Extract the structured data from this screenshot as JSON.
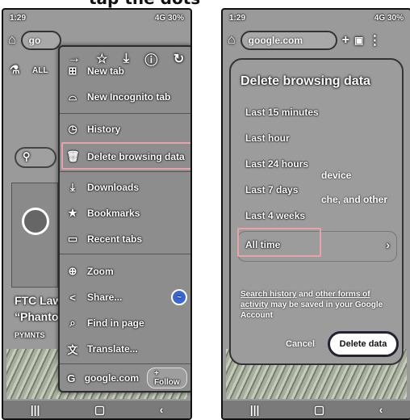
{
  "caption": "tap the dots",
  "left": {
    "status": {
      "time": "1:29",
      "indicators": "4G 30%"
    },
    "omnibox_text": "go",
    "menu": {
      "top_icons": [
        "forward-icon",
        "star-icon",
        "download-icon",
        "info-icon",
        "refresh-icon"
      ],
      "items": [
        {
          "label": "New tab",
          "icon": "plus-box-icon"
        },
        {
          "label": "New Incognito tab",
          "icon": "incognito-icon"
        },
        {
          "label": "History",
          "icon": "history-icon"
        },
        {
          "label": "Delete browsing data",
          "icon": "trash-icon"
        },
        {
          "label": "Downloads",
          "icon": "download-done-icon"
        },
        {
          "label": "Bookmarks",
          "icon": "star-icon"
        },
        {
          "label": "Recent tabs",
          "icon": "devices-icon"
        },
        {
          "label": "Zoom",
          "icon": "zoom-icon"
        },
        {
          "label": "Share...",
          "icon": "share-icon"
        },
        {
          "label": "Find in page",
          "icon": "find-icon"
        },
        {
          "label": "Translate...",
          "icon": "translate-icon"
        },
        {
          "label": "google.com",
          "icon": "google-icon"
        }
      ],
      "follow_label": "+ Follow"
    },
    "tab_label": "ALL",
    "headline_1": "FTC Law",
    "headline_2": "“Phanton",
    "source": "PYMNTS"
  },
  "right": {
    "status": {
      "time": "1:29",
      "indicators": "4G 30%"
    },
    "omnibox_text": "google.com",
    "dialog": {
      "title": "Delete browsing data",
      "options": [
        "Last 15 minutes",
        "Last hour",
        "Last 24 hours",
        "Last 7 days",
        "Last 4 weeks",
        "All time"
      ],
      "bg_text_1": "device",
      "bg_text_2": "che, and other",
      "info_link_1": "Search history",
      "info_and": "and",
      "info_link_2": "other forms of activity",
      "info_rest": "may be saved in your Google Account",
      "cancel_label": "Cancel",
      "delete_label": "Delete data"
    }
  },
  "nav_glyphs": [
    "|||",
    "▢",
    "‹"
  ],
  "colors": {
    "highlight": "#e8a2a8",
    "messenger": "#3a67d8"
  }
}
